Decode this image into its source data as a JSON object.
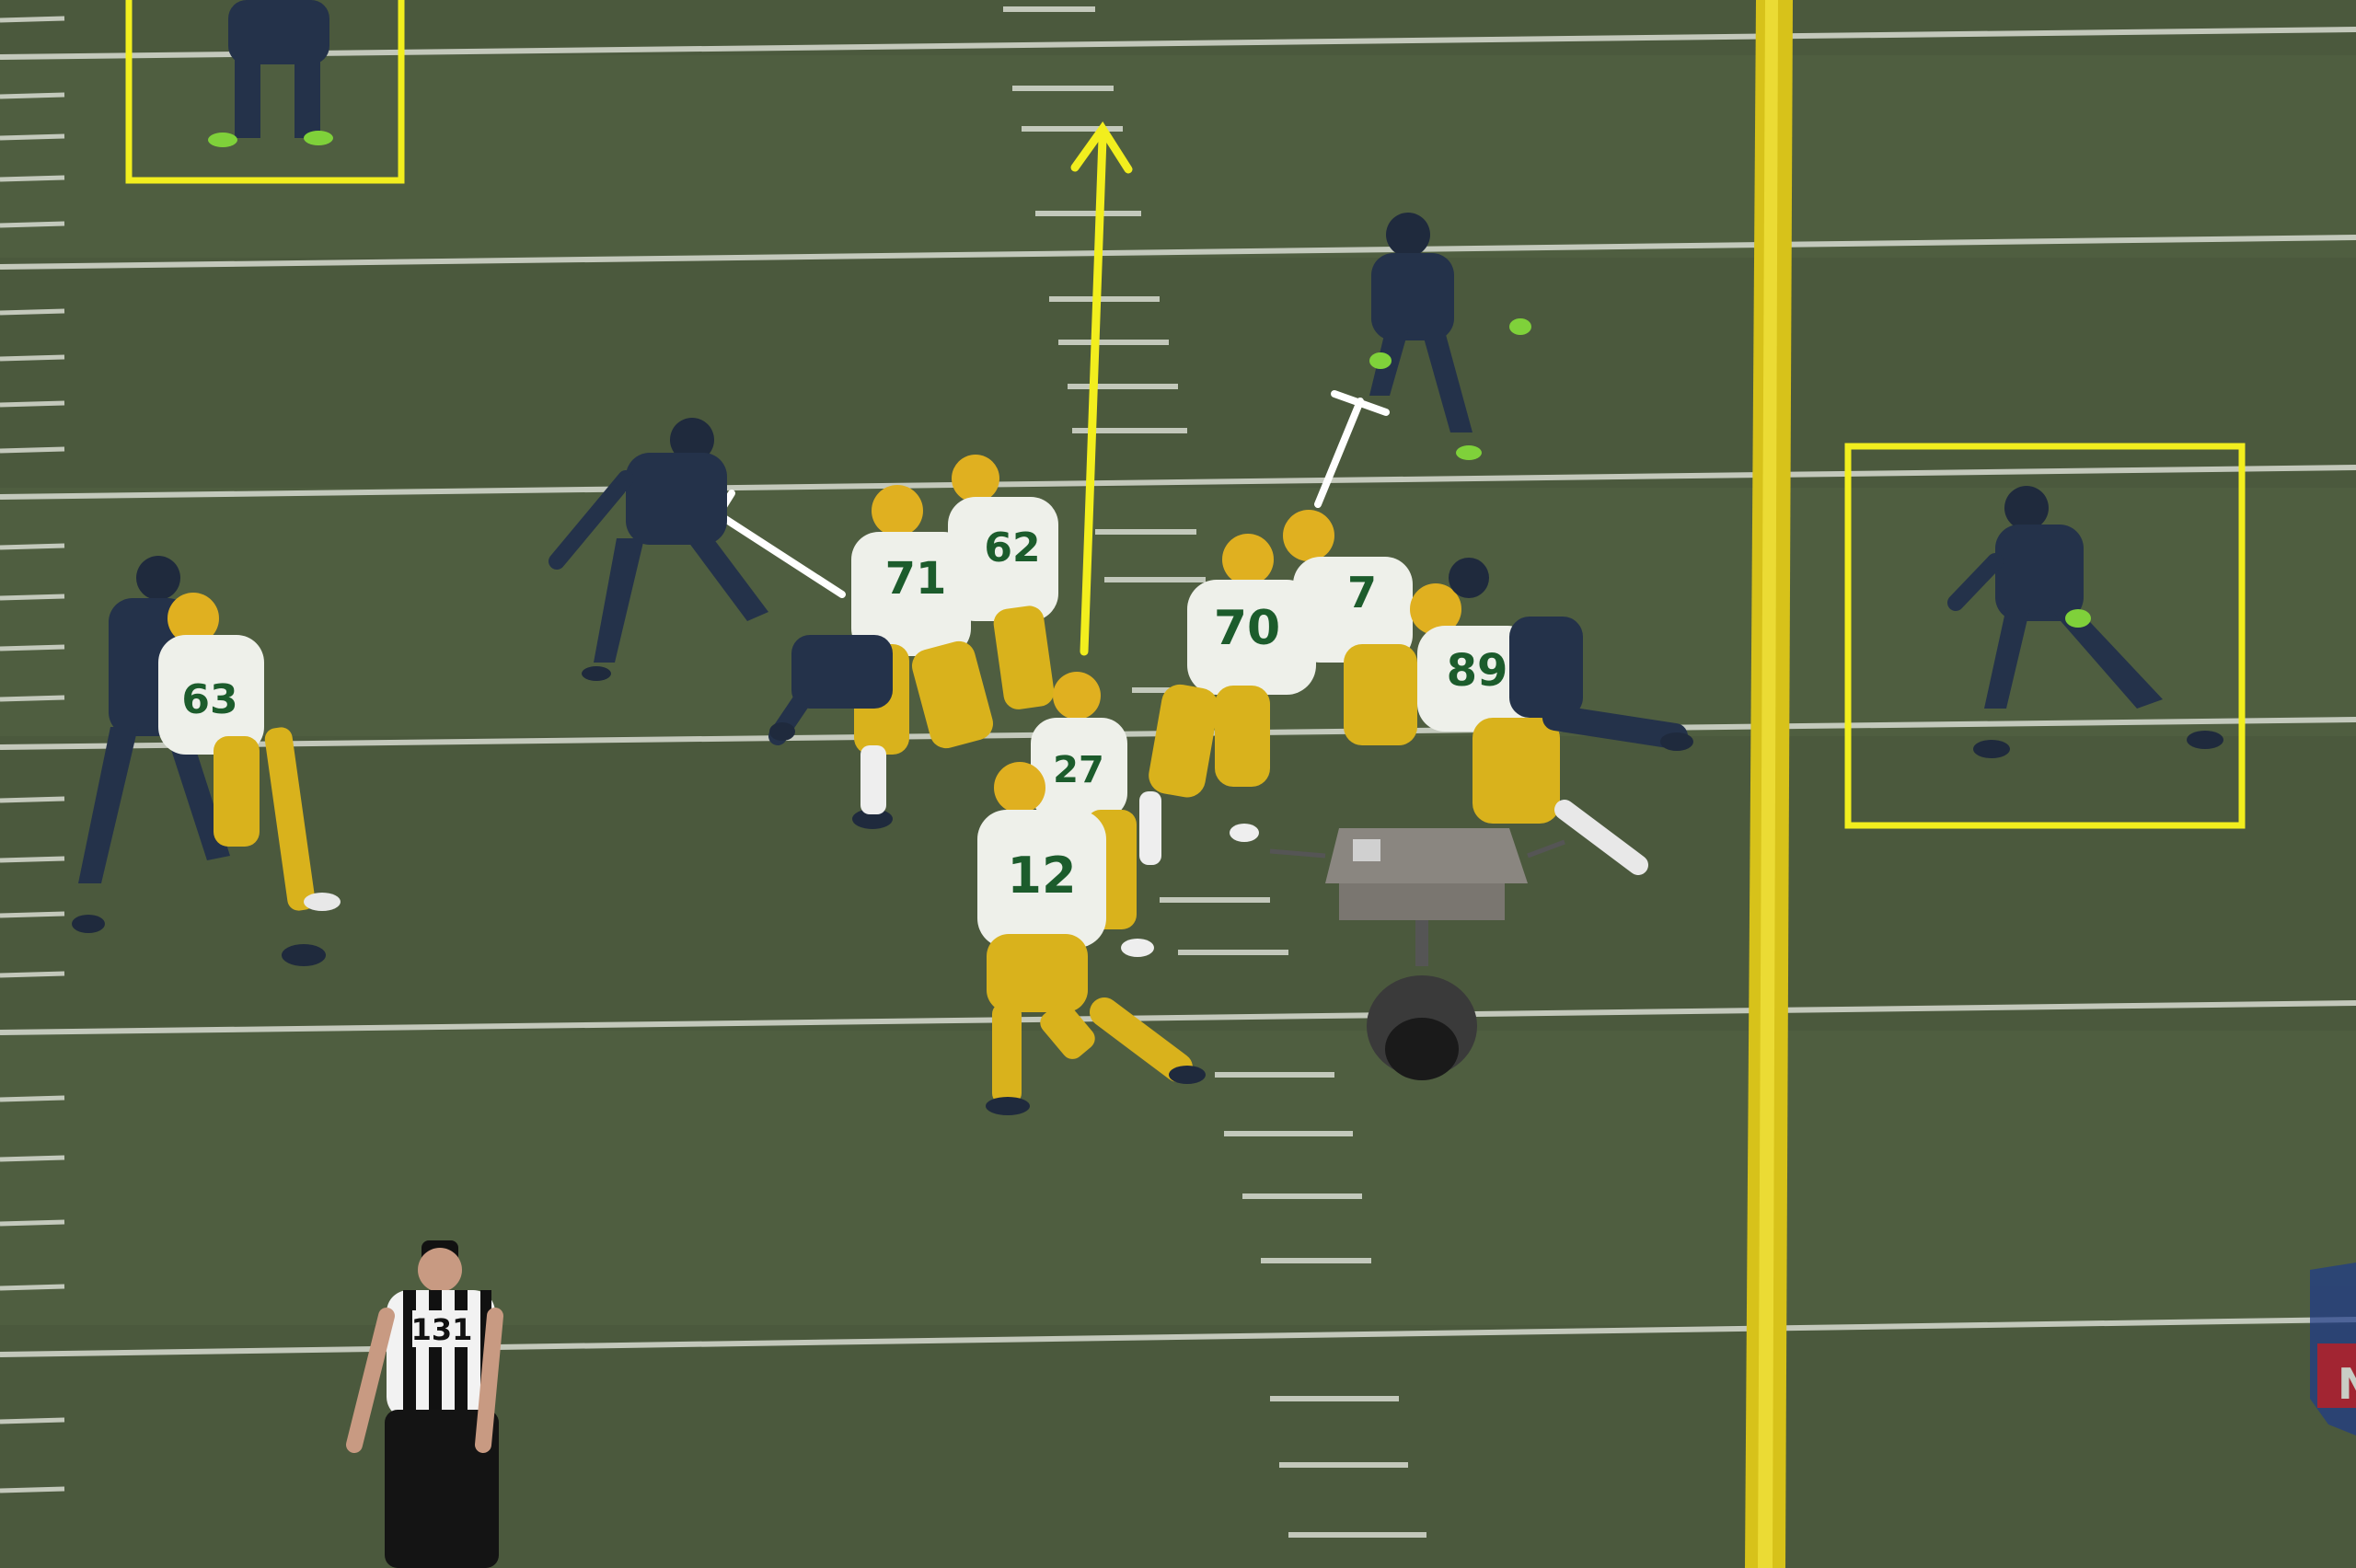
{
  "scene": {
    "description_kind": "broadcast-football-frame",
    "colors": {
      "turf": "#4f5e40",
      "turf_dark": "#44523a",
      "yard_line": "#d8dcd2",
      "annotation_yellow": "#f2ee1e",
      "annotation_white": "#ffffff",
      "home_jersey": "#eef0ea",
      "home_pants": "#d9b21c",
      "home_helmet": "#e0b020",
      "away_jersey": "#24324a",
      "away_accent": "#7fd13a",
      "goal_post": "#e6d21a"
    }
  },
  "players": {
    "home": [
      {
        "id": "p71",
        "number": "71"
      },
      {
        "id": "p63",
        "number": "63"
      },
      {
        "id": "p62",
        "number": "62"
      },
      {
        "id": "p70",
        "number": "70"
      },
      {
        "id": "p7x",
        "number": "7"
      },
      {
        "id": "p89",
        "number": "89"
      },
      {
        "id": "p12",
        "number": "12"
      },
      {
        "id": "prb",
        "number": "27"
      }
    ]
  },
  "official": {
    "number": "131"
  },
  "logo": {
    "text": "NFL"
  }
}
